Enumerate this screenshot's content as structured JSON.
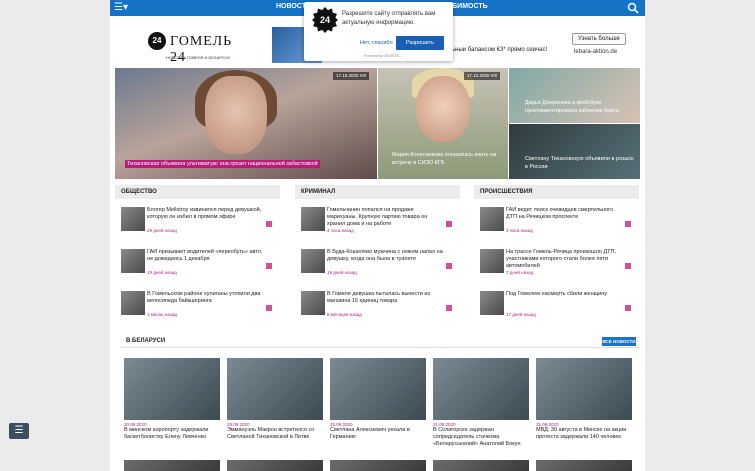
{
  "topbar": {
    "nav_left": "НОВОСТИ",
    "nav_right": "ЛЮБИМОСТЬ"
  },
  "logo": {
    "mark": "24",
    "name": "ГОМЕЛЬ 24",
    "tagline": "НОВОСТИ ГОМЕЛЯ И БЕЛАРУСИ"
  },
  "ad": {
    "text": "ьныи балансом €3* прямо сеичас!",
    "button": "Узнать больше",
    "domain": "lebara-aktion.de"
  },
  "popup": {
    "mark": "24",
    "message": "Разрешите сайту отправлять вам актуальную информацию.",
    "decline": "Нет, спасибо",
    "accept": "Разрешить",
    "powered": "Powered by GRAVITEC"
  },
  "hero": {
    "main": "Тихановская объявила ультиматум: она грозит национальной забастовкой",
    "mid": {
      "date": "17.10.2020",
      "comments": "0",
      "title": "Мария Колесникова отказалась ехать на встречу в СИЗО КГБ"
    },
    "left_meta": {
      "date": "17.10.2020",
      "comments": "0"
    },
    "rt": "Дарья Домрачева в фейсбуке прокомментировала избиение брата",
    "rb": "Светлану Тихановскую объявили в розыск в России"
  },
  "columns": [
    {
      "title": "ОБЩЕСТВО",
      "items": [
        {
          "title": "Блогер Mellstroy извинился перед девушкой, которую он избил в прямом эфире",
          "time": "19 дней назад"
        },
        {
          "title": "ГАИ призывает водителей «переобуть» авто, не дожидаясь 1 декабря",
          "time": "19 дней назад"
        },
        {
          "title": "В Гомельском районе хулиганы утопили два велосипеда байкшеринга",
          "time": "1 месяц назад"
        }
      ]
    },
    {
      "title": "КРИМИНАЛ",
      "items": [
        {
          "title": "Гомельчанин попался на продаже марихуаны. Крупную партию товара он хранил дома и на работе",
          "time": "4 часа назад"
        },
        {
          "title": "В Буда-Кошелево мужчина с ножом напал на девушку, когда она была в туалете",
          "time": "19 дней назад"
        },
        {
          "title": "В Гомеле девушка пыталась вынести из магазина 16 единиц товара",
          "time": "8 месяцев назад"
        }
      ]
    },
    {
      "title": "ПРОИСШЕСТВИЯ",
      "items": [
        {
          "title": "ГАИ ведет поиск очевидцев смертельного ДТП на Речицком проспекте",
          "time": "3 часа назад"
        },
        {
          "title": "На трассе Гомель-Речица произошло ДТП, участниками которого стали более пяти автомобилей",
          "time": "7 дней назад"
        },
        {
          "title": "Под Гомелем насмерть сбили женщину",
          "time": "17 дней назад"
        }
      ]
    }
  ],
  "belarus": {
    "title": "В БЕЛАРУСИ",
    "all": "ВСЕ НОВОСТИ",
    "cards": [
      {
        "date": "30.09.2020",
        "title": "В минском аэропорту задержали баскетболистку Елену Левченко"
      },
      {
        "date": "29.09.2020",
        "title": "Эммануэль Макрон встретился со Светланой Тихановской в Литве"
      },
      {
        "date": "25.09.2020",
        "title": "Светлана Алексиевич уехала в Германию"
      },
      {
        "date": "31.08.2020",
        "title": "В Солигорске задержан сопредседатель стачкома «Беларуськалий» Анатолий Бокун"
      },
      {
        "date": "31.08.2020",
        "title": "МВД: 30 августа в Минске на акции протеста задержали 140 человек"
      }
    ]
  }
}
